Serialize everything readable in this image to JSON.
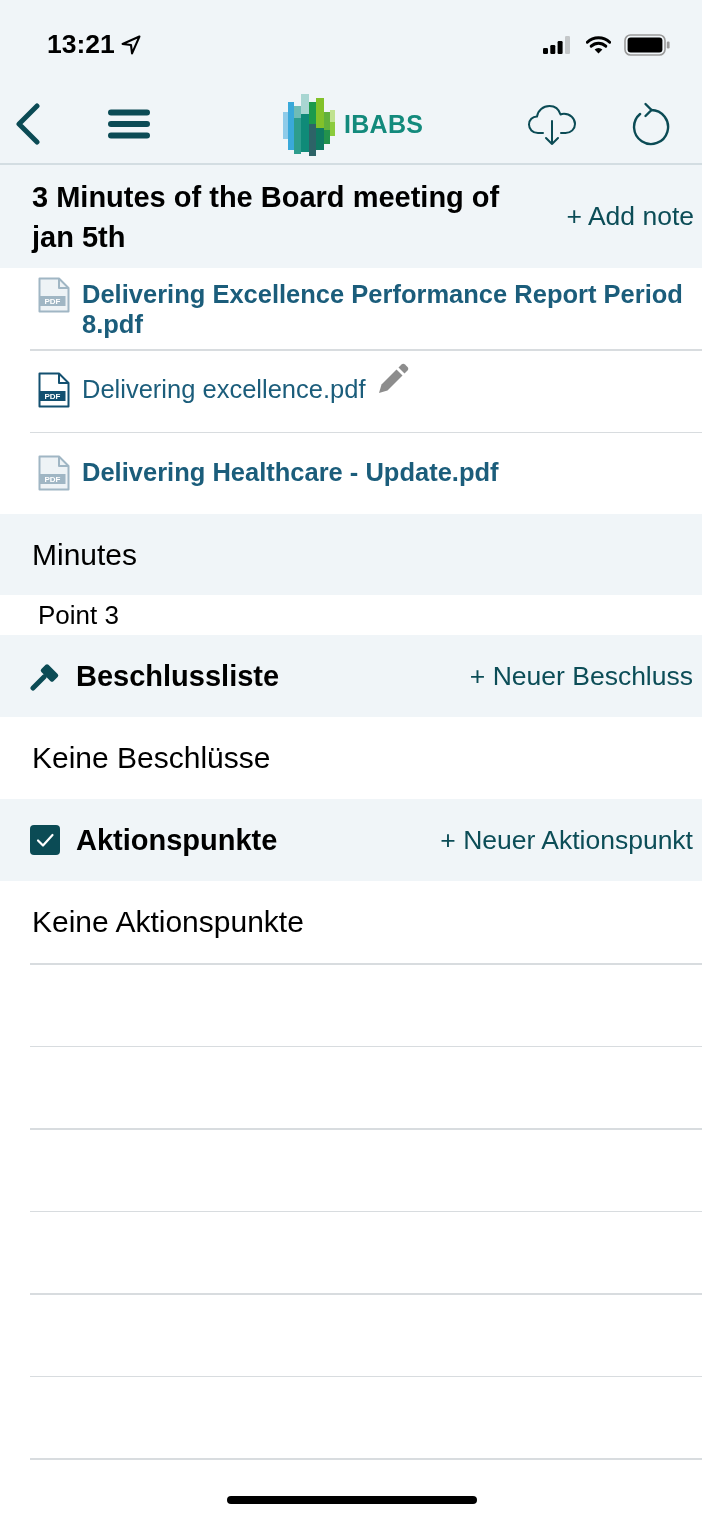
{
  "status_bar": {
    "time": "13:21"
  },
  "nav_bar": {
    "logo_text": "IBABS"
  },
  "agenda_item": {
    "title": "3 Minutes of the Board meeting of jan 5th",
    "add_note": "+ Add note"
  },
  "documents": [
    {
      "name": "Delivering Excellence Performance Report Period 8.pdf",
      "file_type": "PDF",
      "unread": true,
      "annotated": false
    },
    {
      "name": "Delivering excellence.pdf",
      "file_type": "PDF",
      "unread": false,
      "annotated": true
    },
    {
      "name": "Delivering Healthcare - Update.pdf",
      "file_type": "PDF",
      "unread": true,
      "annotated": false
    }
  ],
  "minutes": {
    "heading": "Minutes",
    "text": "Point 3"
  },
  "sections": [
    {
      "kind": "decisions",
      "title": "Beschlussliste",
      "action": "+ Neuer Beschluss",
      "empty_text": "Keine Beschlüsse"
    },
    {
      "kind": "action_items",
      "title": "Aktionspunkte",
      "action": "+ Neuer Aktionspunkt",
      "empty_text": "Keine Aktionspunkte"
    }
  ]
}
